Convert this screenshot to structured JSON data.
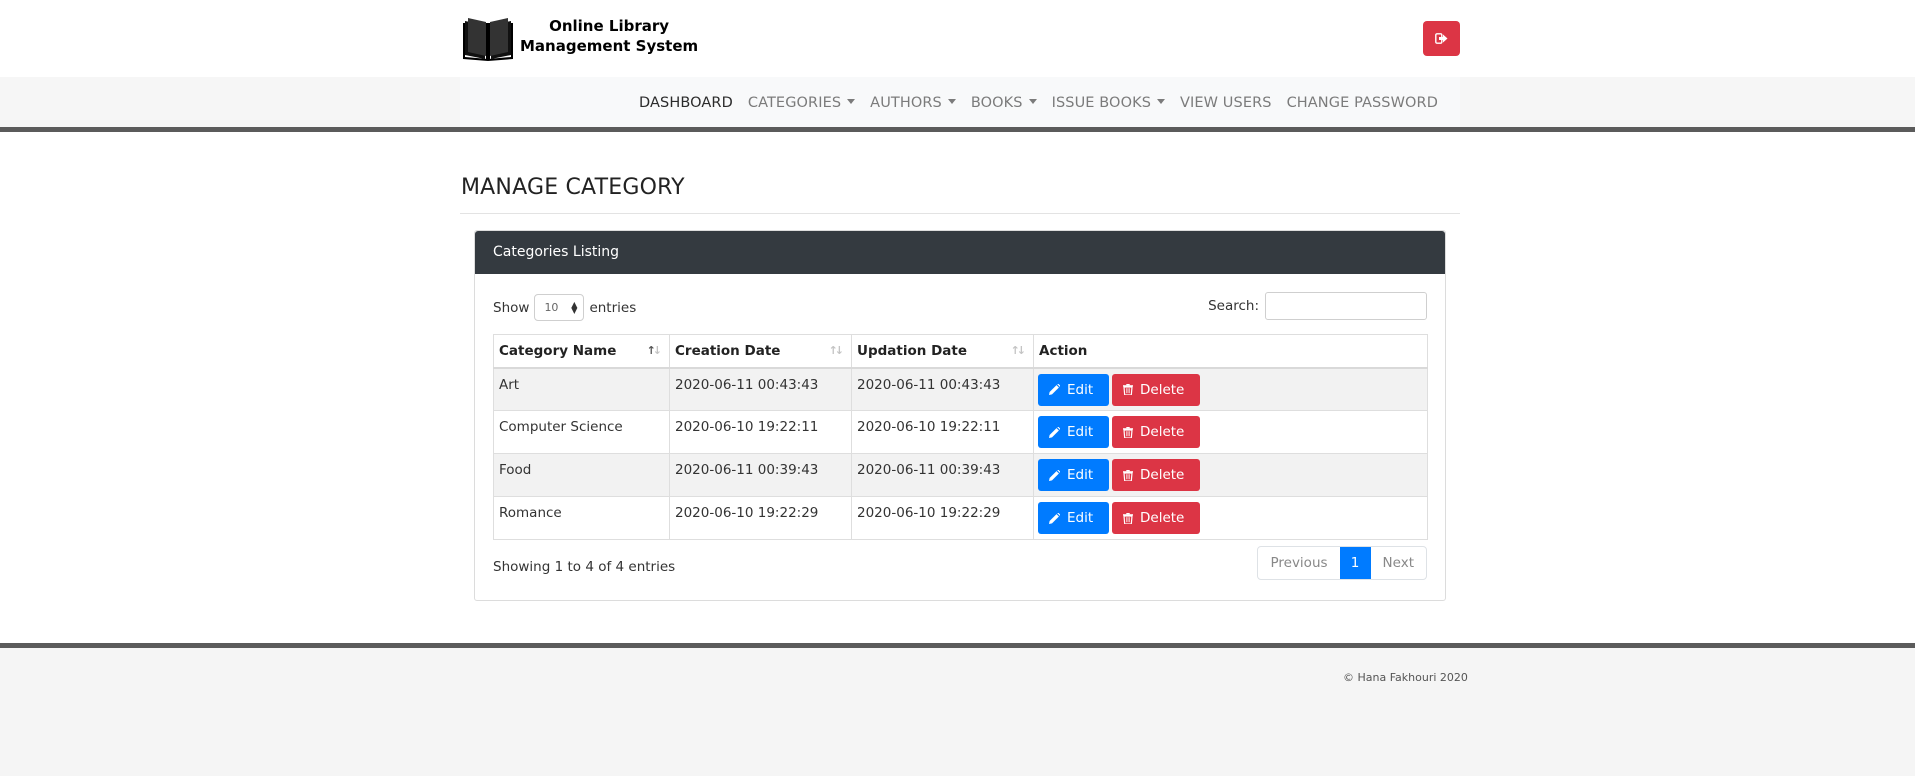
{
  "brand": {
    "line1": "Online Library",
    "line2": "Management System",
    "logo_icon": "open-book-icon"
  },
  "logout_icon": "logout-icon",
  "nav": {
    "items": [
      {
        "label": "DASHBOARD",
        "dropdown": false,
        "active": true
      },
      {
        "label": "CATEGORIES",
        "dropdown": true
      },
      {
        "label": "AUTHORS",
        "dropdown": true
      },
      {
        "label": "BOOKS",
        "dropdown": true
      },
      {
        "label": "ISSUE BOOKS",
        "dropdown": true
      },
      {
        "label": "VIEW USERS",
        "dropdown": false
      },
      {
        "label": "CHANGE PASSWORD",
        "dropdown": false
      }
    ]
  },
  "page": {
    "title": "MANAGE CATEGORY"
  },
  "panel": {
    "title": "Categories Listing",
    "show_label": "Show",
    "entries_value": "10",
    "entries_label": "entries",
    "search_label": "Search:",
    "search_value": ""
  },
  "table": {
    "headers": [
      "Category Name",
      "Creation Date",
      "Updation Date",
      "Action"
    ],
    "rows": [
      {
        "name": "Art",
        "created": "2020-06-11 00:43:43",
        "updated": "2020-06-11 00:43:43"
      },
      {
        "name": "Computer Science",
        "created": "2020-06-10 19:22:11",
        "updated": "2020-06-10 19:22:11"
      },
      {
        "name": "Food",
        "created": "2020-06-11 00:39:43",
        "updated": "2020-06-11 00:39:43"
      },
      {
        "name": "Romance",
        "created": "2020-06-10 19:22:29",
        "updated": "2020-06-10 19:22:29"
      }
    ],
    "edit_label": "Edit",
    "delete_label": "Delete"
  },
  "info": "Showing 1 to 4 of 4 entries",
  "pagination": {
    "previous": "Previous",
    "current": "1",
    "next": "Next"
  },
  "footer": {
    "copyright": "© Hana Fakhouri 2020"
  },
  "colors": {
    "primary": "#007bff",
    "danger": "#dc3545",
    "dark": "#343a40"
  }
}
